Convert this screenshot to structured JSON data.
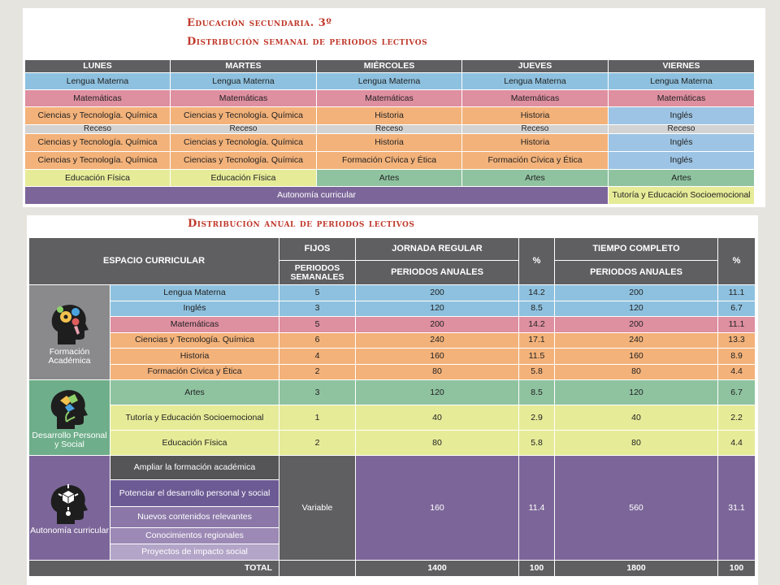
{
  "weekly": {
    "title": "Educación secundaria. 3º",
    "subtitle": "Distribución semanal de periodos lectivos",
    "days": [
      "LUNES",
      "MARTES",
      "MIÉRCOLES",
      "JUEVES",
      "VIERNES"
    ],
    "rows": [
      [
        "Lengua Materna",
        "Lengua Materna",
        "Lengua Materna",
        "Lengua Materna",
        "Lengua Materna"
      ],
      [
        "Matemáticas",
        "Matemáticas",
        "Matemáticas",
        "Matemáticas",
        "Matemáticas"
      ],
      [
        "Ciencias y Tecnología. Química",
        "Ciencias y Tecnología. Química",
        "Historia",
        "Historia",
        "Inglés"
      ],
      [
        "Receso",
        "Receso",
        "Receso",
        "Receso",
        "Receso"
      ],
      [
        "Ciencias y Tecnología. Química",
        "Ciencias y Tecnología. Química",
        "Historia",
        "Historia",
        "Inglés"
      ],
      [
        "Ciencias y Tecnología. Química",
        "Ciencias y Tecnología. Química",
        "Formación Cívica y Ética",
        "Formación Cívica y Ética",
        "Inglés"
      ],
      [
        "Educación Física",
        "Educación Física",
        "Artes",
        "Artes",
        "Artes"
      ]
    ],
    "autonomia": "Autonomía curricular",
    "tutoria": "Tutoría y Educación Socioemocional"
  },
  "annual": {
    "title": "Distribución anual de periodos lectivos",
    "headers": {
      "espacio": "ESPACIO CURRICULAR",
      "fijos": "FIJOS",
      "periodos_semanales": "PERIODOS SEMANALES",
      "jornada_regular": "JORNADA REGULAR",
      "periodos_anuales_1": "PERIODOS ANUALES",
      "pct_1": "%",
      "tiempo_completo": "TIEMPO COMPLETO",
      "periodos_anuales_2": "PERIODOS ANUALES",
      "pct_2": "%"
    },
    "groups": {
      "formacion": "Formación Académica",
      "desarrollo": "Desarrollo Personal y Social",
      "autonomia": "Autonomía curricular"
    },
    "rows": [
      {
        "name": "Lengua Materna",
        "sem": "5",
        "jr": "200",
        "jr_pct": "14.2",
        "tc": "200",
        "tc_pct": "11.1"
      },
      {
        "name": "Inglés",
        "sem": "3",
        "jr": "120",
        "jr_pct": "8.5",
        "tc": "120",
        "tc_pct": "6.7"
      },
      {
        "name": "Matemáticas",
        "sem": "5",
        "jr": "200",
        "jr_pct": "14.2",
        "tc": "200",
        "tc_pct": "11.1"
      },
      {
        "name": "Ciencias y Tecnología. Química",
        "sem": "6",
        "jr": "240",
        "jr_pct": "17.1",
        "tc": "240",
        "tc_pct": "13.3"
      },
      {
        "name": "Historia",
        "sem": "4",
        "jr": "160",
        "jr_pct": "11.5",
        "tc": "160",
        "tc_pct": "8.9"
      },
      {
        "name": "Formación Cívica y Ética",
        "sem": "2",
        "jr": "80",
        "jr_pct": "5.8",
        "tc": "80",
        "tc_pct": "4.4"
      },
      {
        "name": "Artes",
        "sem": "3",
        "jr": "120",
        "jr_pct": "8.5",
        "tc": "120",
        "tc_pct": "6.7"
      },
      {
        "name": "Tutoría y Educación Socioemocional",
        "sem": "1",
        "jr": "40",
        "jr_pct": "2.9",
        "tc": "40",
        "tc_pct": "2.2"
      },
      {
        "name": "Educación Física",
        "sem": "2",
        "jr": "80",
        "jr_pct": "5.8",
        "tc": "80",
        "tc_pct": "4.4"
      }
    ],
    "autonomia_items": [
      "Ampliar la formación académica",
      "Potenciar el desarrollo personal y social",
      "Nuevos contenidos relevantes",
      "Conocimientos regionales",
      "Proyectos de impacto social"
    ],
    "autonomia_values": {
      "sem": "Variable",
      "jr": "160",
      "jr_pct": "11.4",
      "tc": "560",
      "tc_pct": "31.1"
    },
    "total": {
      "label": "TOTAL",
      "jr": "1400",
      "jr_pct": "100",
      "tc": "1800",
      "tc_pct": "100"
    }
  }
}
